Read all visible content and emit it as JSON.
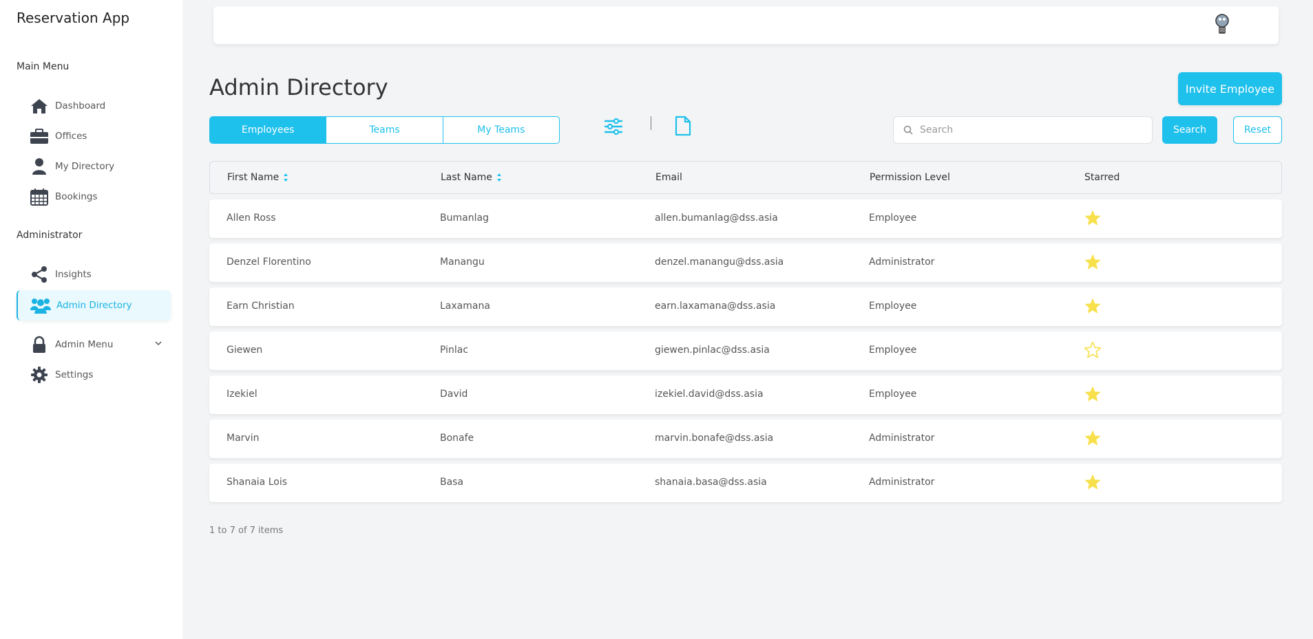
{
  "app": {
    "title": "Reservation App"
  },
  "sidebar": {
    "main_heading": "Main Menu",
    "main_items": [
      {
        "label": "Dashboard",
        "icon": "home-icon"
      },
      {
        "label": "Offices",
        "icon": "briefcase-icon"
      },
      {
        "label": "My Directory",
        "icon": "user-icon"
      },
      {
        "label": "Bookings",
        "icon": "calendar-icon"
      }
    ],
    "admin_heading": "Administrator",
    "admin_items": [
      {
        "label": "Insights",
        "icon": "share-icon"
      },
      {
        "label": "Admin Directory",
        "icon": "users-icon",
        "active": true
      },
      {
        "label": "Admin Menu",
        "icon": "lock-icon"
      },
      {
        "label": "Settings",
        "icon": "gear-icon"
      }
    ]
  },
  "header": {
    "avatar_icon": "avatar-icon"
  },
  "page": {
    "title": "Admin Directory",
    "invite_label": "Invite Employee",
    "tabs": [
      {
        "label": "Employees",
        "active": true
      },
      {
        "label": "Teams",
        "active": false
      },
      {
        "label": "My Teams",
        "active": false
      }
    ],
    "search": {
      "placeholder": "Search",
      "value": "",
      "button_label": "Search",
      "reset_label": "Reset"
    }
  },
  "table": {
    "columns": [
      "First Name",
      "Last Name",
      "Email",
      "Permission Level",
      "Starred"
    ],
    "rows": [
      {
        "first": "Allen Ross",
        "last": "Bumanlag",
        "email": "allen.bumanlag@dss.asia",
        "level": "Employee",
        "starred": true
      },
      {
        "first": "Denzel Florentino",
        "last": "Manangu",
        "email": "denzel.manangu@dss.asia",
        "level": "Administrator",
        "starred": true
      },
      {
        "first": "Earn Christian",
        "last": "Laxamana",
        "email": "earn.laxamana@dss.asia",
        "level": "Employee",
        "starred": true
      },
      {
        "first": "Giewen",
        "last": "Pinlac",
        "email": "giewen.pinlac@dss.asia",
        "level": "Employee",
        "starred": false
      },
      {
        "first": "Izekiel",
        "last": "David",
        "email": "izekiel.david@dss.asia",
        "level": "Employee",
        "starred": true
      },
      {
        "first": "Marvin",
        "last": "Bonafe",
        "email": "marvin.bonafe@dss.asia",
        "level": "Administrator",
        "starred": true
      },
      {
        "first": "Shanaia Lois",
        "last": "Basa",
        "email": "shanaia.basa@dss.asia",
        "level": "Administrator",
        "starred": true
      }
    ]
  },
  "pagination": {
    "summary": "1 to 7 of 7 items"
  },
  "colors": {
    "accent": "#1ec0ec",
    "star": "#f7e04b",
    "sidebar_icon": "#3d4450"
  }
}
